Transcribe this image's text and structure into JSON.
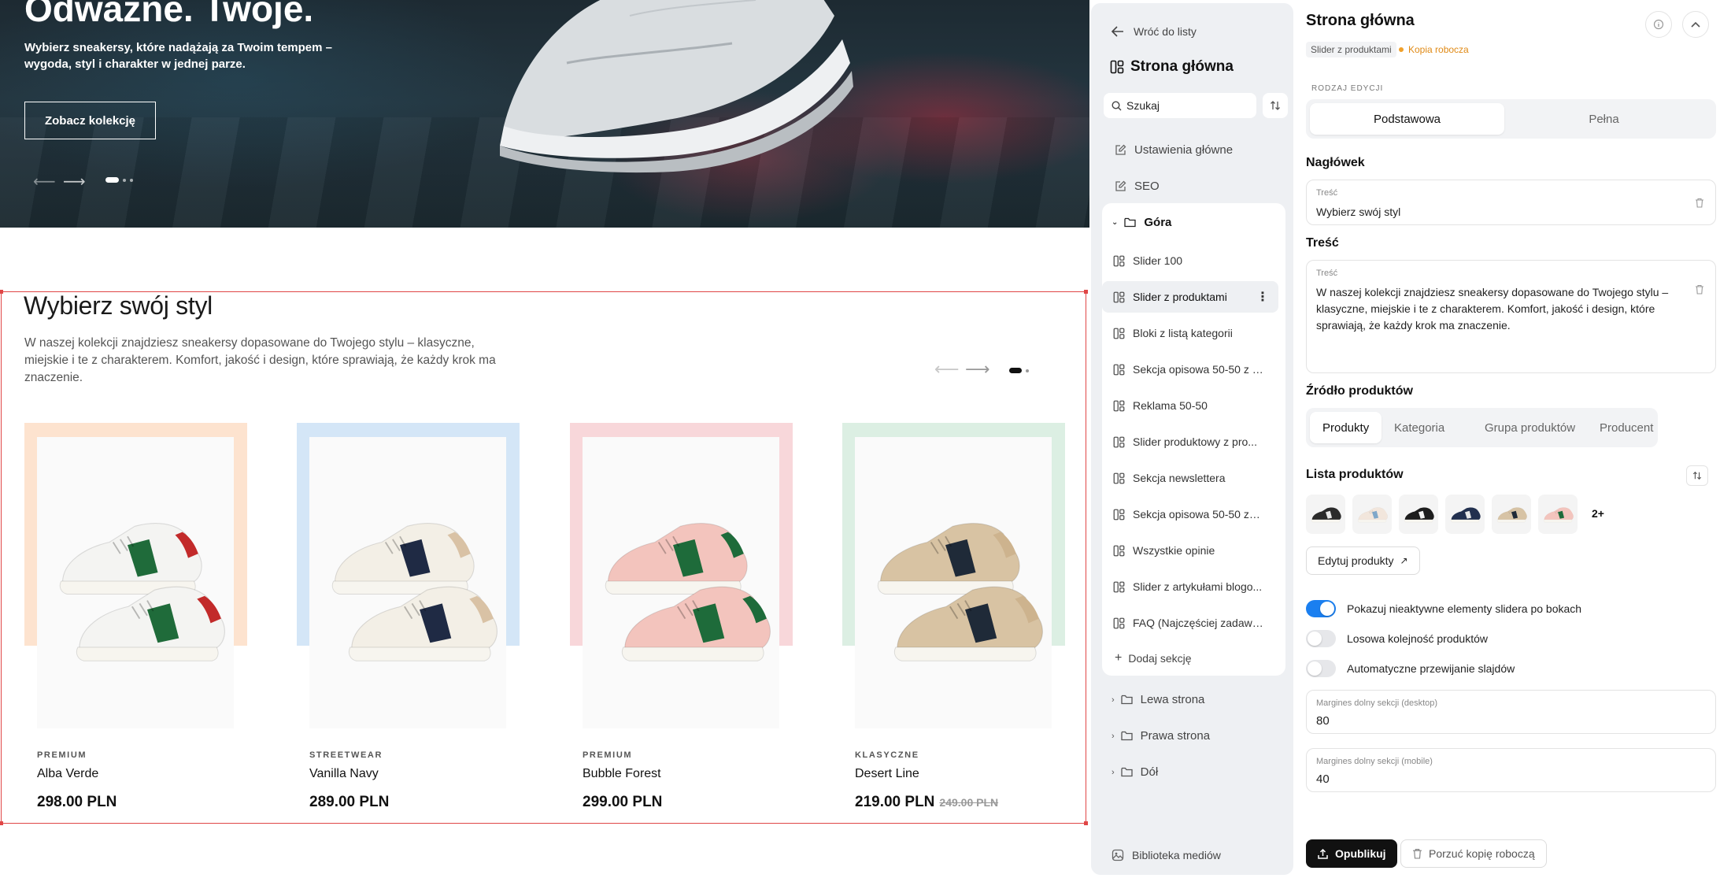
{
  "preview": {
    "hero": {
      "title": "Odważne. Twoje.",
      "subtitle": "Wybierz sneakersy, które nadążają za Twoim tempem – wygoda, styl i charakter w jednej parze.",
      "button": "Zobacz kolekcję",
      "arrow_prev": "⟵",
      "arrow_next": "⟶"
    },
    "section": {
      "title": "Wybierz swój styl",
      "description": "W naszej kolekcji znajdziesz sneakersy dopasowane do Twojego stylu – klasyczne, miejskie i te z charakterem. Komfort, jakość i design, które sprawiają, że każdy krok ma znaczenie.",
      "arrow_prev": "⟵",
      "arrow_next": "⟶"
    },
    "products": [
      {
        "category": "PREMIUM",
        "name": "Alba Verde",
        "price": "298.00 PLN",
        "old_price": "",
        "bg": "#fde3cf",
        "body": "#f4f4f2",
        "accent": "#1f6b3a",
        "heel": "#c22a2a"
      },
      {
        "category": "STREETWEAR",
        "name": "Vanilla Navy",
        "price": "289.00 PLN",
        "old_price": "",
        "bg": "#d4e6f7",
        "body": "#f3efe6",
        "accent": "#1f2a44",
        "heel": "#d9c2a5"
      },
      {
        "category": "PREMIUM",
        "name": "Bubble Forest",
        "price": "299.00 PLN",
        "old_price": "",
        "bg": "#f8d7da",
        "body": "#f3c4bd",
        "accent": "#1e6b3a",
        "heel": "#1e6b3a"
      },
      {
        "category": "KLASYCZNE",
        "name": "Desert Line",
        "price": "219.00 PLN",
        "old_price": "249.00 PLN",
        "bg": "#dcefe3",
        "body": "#d8c3a3",
        "accent": "#1f2a38",
        "heel": "#cdb38e"
      }
    ]
  },
  "nav": {
    "back": "Wróć do listy",
    "title": "Strona główna",
    "search_placeholder": "Szukaj",
    "top_items": [
      "Ustawienia główne",
      "SEO"
    ],
    "group_open": "Góra",
    "sections": [
      "Slider 100",
      "Slider z produktami",
      "Bloki z listą kategorii",
      "Sekcja opisowa 50-50 z p...",
      "Reklama 50-50",
      "Slider produktowy z pro...",
      "Sekcja newslettera",
      "Sekcja opisowa 50-50 ze ...",
      "Wszystkie opinie",
      "Slider z artykułami blogo...",
      "FAQ (Najczęściej zadawa..."
    ],
    "add_section": "Dodaj sekcję",
    "groups_closed": [
      "Lewa strona",
      "Prawa strona",
      "Dół"
    ],
    "media_library": "Biblioteka mediów"
  },
  "editor": {
    "title": "Strona główna",
    "badge_type": "Slider z produktami",
    "badge_draft": "Kopia robocza",
    "edit_mode_label": "RODZAJ EDYCJI",
    "edit_modes": [
      "Podstawowa",
      "Pełna"
    ],
    "heading_label": "Nagłówek",
    "heading_field_label": "Treść",
    "heading_value": "Wybierz swój styl",
    "content_label": "Treść",
    "content_field_label": "Treść",
    "content_value": "W naszej kolekcji znajdziesz sneakersy dopasowane do Twojego stylu – klasyczne, miejskie i te z charakterem. Komfort, jakość i design, które sprawiają, że każdy krok ma znaczenie.",
    "source_label": "Źródło produktów",
    "source_options": [
      "Produkty",
      "Kategoria",
      "Grupa produktów",
      "Producent"
    ],
    "product_list_label": "Lista produktów",
    "thumbs": [
      {
        "body": "#2b2b2b",
        "accent": "#e9e9e9"
      },
      {
        "body": "#f2e6dc",
        "accent": "#7fa7c9"
      },
      {
        "body": "#1d1d1d",
        "accent": "#f2f2f2"
      },
      {
        "body": "#22304f",
        "accent": "#e8e8e8"
      },
      {
        "body": "#d7c3a5",
        "accent": "#1f2a38"
      },
      {
        "body": "#f3c4bd",
        "accent": "#1e6b3a"
      }
    ],
    "more_count": "2+",
    "edit_products": "Edytuj produkty",
    "toggles": [
      {
        "label": "Pokazuj nieaktywne elementy slidera po bokach",
        "on": true
      },
      {
        "label": "Losowa kolejność produktów",
        "on": false
      },
      {
        "label": "Automatyczne przewijanie slajdów",
        "on": false
      }
    ],
    "margin_desktop_label": "Margines dolny sekcji (desktop)",
    "margin_desktop_value": "80",
    "margin_mobile_label": "Margines dolny sekcji (mobile)",
    "margin_mobile_value": "40",
    "publish": "Opublikuj",
    "discard": "Porzuć kopię roboczą"
  }
}
